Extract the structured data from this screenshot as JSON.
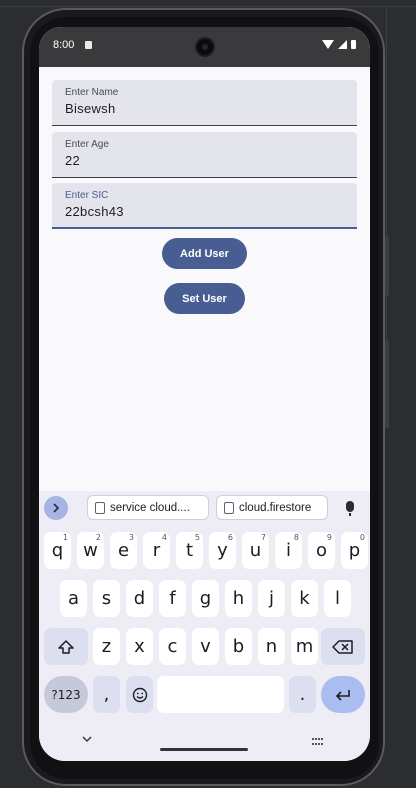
{
  "status_bar": {
    "time": "8:00"
  },
  "form": {
    "name": {
      "label": "Enter Name",
      "value": "Bisewsh"
    },
    "age": {
      "label": "Enter Age",
      "value": "22"
    },
    "sic": {
      "label": "Enter SIC",
      "value": "22bcsh43"
    }
  },
  "buttons": {
    "add_user": "Add User",
    "set_user": "Set User"
  },
  "keyboard": {
    "suggestions": [
      "service cloud....",
      "cloud.firestore"
    ],
    "row1": [
      {
        "key": "q",
        "hint": "1"
      },
      {
        "key": "w",
        "hint": "2"
      },
      {
        "key": "e",
        "hint": "3"
      },
      {
        "key": "r",
        "hint": "4"
      },
      {
        "key": "t",
        "hint": "5"
      },
      {
        "key": "y",
        "hint": "6"
      },
      {
        "key": "u",
        "hint": "7"
      },
      {
        "key": "i",
        "hint": "8"
      },
      {
        "key": "o",
        "hint": "9"
      },
      {
        "key": "p",
        "hint": "0"
      }
    ],
    "row2": [
      "a",
      "s",
      "d",
      "f",
      "g",
      "h",
      "j",
      "k",
      "l"
    ],
    "row3": [
      "z",
      "x",
      "c",
      "v",
      "b",
      "n",
      "m"
    ],
    "bottom": {
      "symbols": "?123",
      "comma": ",",
      "period": "."
    }
  },
  "icons": {
    "expand": "chevron-right-icon",
    "clipboard": "clipboard-icon",
    "mic": "mic-icon",
    "shift": "shift-icon",
    "backspace": "backspace-icon",
    "emoji": "emoji-icon",
    "enter": "enter-icon"
  },
  "colors": {
    "button": "#485e92",
    "focus": "#4a5d92",
    "enter_key": "#a9bdf0"
  }
}
